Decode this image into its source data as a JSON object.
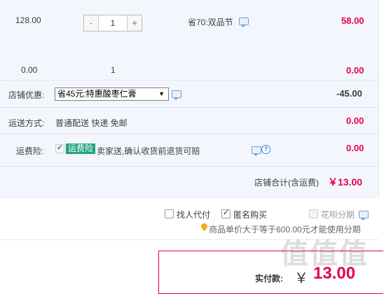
{
  "item1": {
    "unit_price": "128.00",
    "quantity_minus": "-",
    "quantity_value": "1",
    "quantity_plus": "+",
    "promo": "省70:双品节",
    "subtotal": "58.00"
  },
  "item2": {
    "unit_price": "0.00",
    "quantity": "1",
    "subtotal": "0.00"
  },
  "shop_discount": {
    "label": "店铺优惠:",
    "selected": "省45元:特惠酸枣仁膏",
    "amount": "-45.00"
  },
  "shipping": {
    "label": "运送方式:",
    "method": "普通配送 快递 免邮",
    "amount": "0.00"
  },
  "shipping_insurance": {
    "label": "运费险:",
    "badge": "运费险",
    "description": "卖家送,确认收货前退货可赔",
    "amount": "0.00"
  },
  "shop_total": {
    "label": "店铺合计(含运费)",
    "amount": "￥13.00"
  },
  "options": {
    "proxy_pay": "找人代付",
    "anonymous": "匿名购买",
    "installment": "花呗分期",
    "installment_note": "商品单价大于等于600.00元才能使用分期"
  },
  "payment": {
    "label": "实付款:",
    "currency": "￥",
    "amount": "13.00"
  },
  "watermark": "值值值",
  "colors": {
    "price_red": "#e4004f",
    "panel_bg": "#f3f7fd",
    "badge_green": "#21a37a",
    "link_blue": "#3a86d4"
  }
}
